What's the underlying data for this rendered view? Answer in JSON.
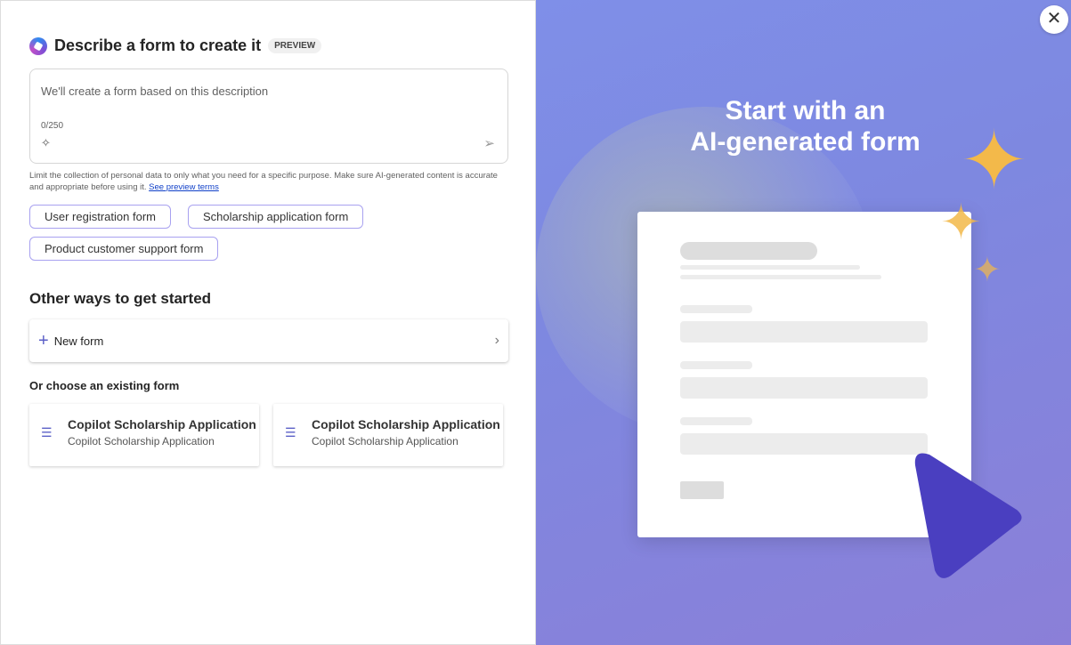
{
  "header": {
    "title": "Describe a form to create it",
    "badge": "PREVIEW"
  },
  "prompt": {
    "placeholder": "We'll create a form based on this description",
    "counter": "0/250"
  },
  "disclaimer": {
    "text": "Limit the collection of personal data to only what you need for a specific purpose. Make sure AI-generated content is accurate and appropriate before using it.",
    "link": "See preview terms"
  },
  "suggestions": [
    "User registration form",
    "Scholarship application form",
    "Product customer support form"
  ],
  "other": {
    "heading": "Other ways to get started",
    "new_form": "New form",
    "existing_label": "Or choose an existing form"
  },
  "existing_forms": [
    {
      "title": "Copilot Scholarship Application",
      "subtitle": "Copilot Scholarship Application"
    },
    {
      "title": "Copilot Scholarship Application",
      "subtitle": "Copilot Scholarship Application"
    }
  ],
  "hero": {
    "line1": "Start with an",
    "line2": "AI-generated form"
  },
  "colors": {
    "accent": "#5b5fc7",
    "hero_bg": "#7f8fe8",
    "arrow": "#4a3fc0"
  }
}
